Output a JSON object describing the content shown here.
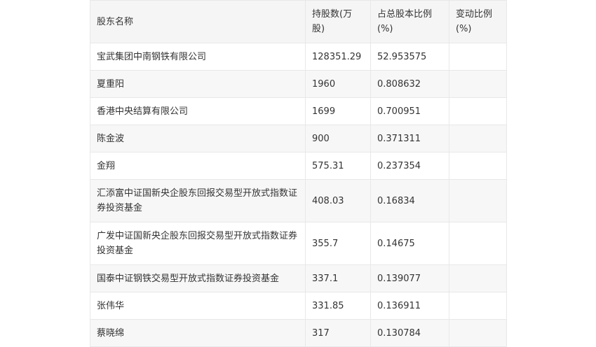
{
  "table": {
    "headers": [
      "股东名称",
      "持股数(万股)",
      "占总股本比例(%)",
      "变动比例(%)"
    ],
    "rows": [
      {
        "name": "宝武集团中南钢铁有限公司",
        "shares": "128351.29",
        "ratio": "52.953575",
        "change": ""
      },
      {
        "name": "夏重阳",
        "shares": "1960",
        "ratio": "0.808632",
        "change": ""
      },
      {
        "name": "香港中央结算有限公司",
        "shares": "1699",
        "ratio": "0.700951",
        "change": ""
      },
      {
        "name": "陈金波",
        "shares": "900",
        "ratio": "0.371311",
        "change": ""
      },
      {
        "name": "金翔",
        "shares": "575.31",
        "ratio": "0.237354",
        "change": ""
      },
      {
        "name": "汇添富中证国新央企股东回报交易型开放式指数证券投资基金",
        "shares": "408.03",
        "ratio": "0.16834",
        "change": ""
      },
      {
        "name": "广发中证国新央企股东回报交易型开放式指数证券投资基金",
        "shares": "355.7",
        "ratio": "0.14675",
        "change": ""
      },
      {
        "name": "国泰中证钢铁交易型开放式指数证券投资基金",
        "shares": "337.1",
        "ratio": "0.139077",
        "change": ""
      },
      {
        "name": "张伟华",
        "shares": "331.85",
        "ratio": "0.136911",
        "change": ""
      },
      {
        "name": "蔡晓绵",
        "shares": "317",
        "ratio": "0.130784",
        "change": ""
      }
    ]
  }
}
